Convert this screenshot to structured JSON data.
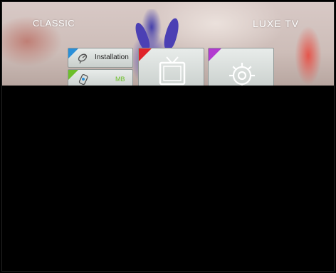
{
  "brand": {
    "left": "CLASSIC",
    "right": "LUXE TV"
  },
  "menu": {
    "items": [
      {
        "label": "Installation",
        "icon": "satellite-dish-icon",
        "accent": "#2a8fd8"
      },
      {
        "label": "MB",
        "icon": "media-icon",
        "accent": "#6dbf2a"
      }
    ],
    "tiles": [
      {
        "icon": "tv-icon",
        "accent": "#e0242a"
      },
      {
        "icon": "gear-icon",
        "accent": "#b23ad0"
      }
    ]
  }
}
